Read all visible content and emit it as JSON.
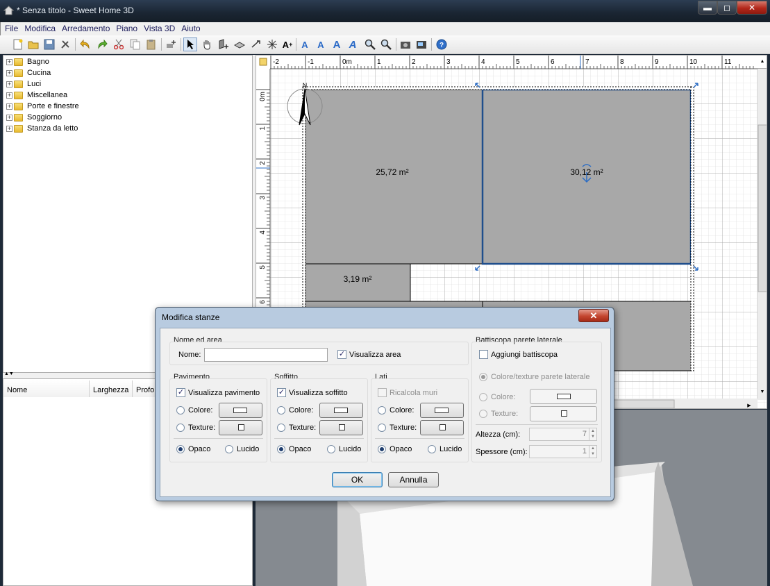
{
  "window": {
    "title": "* Senza titolo - Sweet Home 3D",
    "minimize": "▬",
    "maximize": "◻",
    "close": "✕"
  },
  "menu": [
    "File",
    "Modifica",
    "Arredamento",
    "Piano",
    "Vista 3D",
    "Aiuto"
  ],
  "toolbar_icons": [
    "new-icon",
    "open-icon",
    "save-icon",
    "preferences-icon",
    "undo-icon",
    "redo-icon",
    "cut-icon",
    "copy-icon",
    "paste-icon",
    "add-furniture-icon",
    "select-icon",
    "pan-icon",
    "create-walls-icon",
    "create-rooms-icon",
    "create-dimensions-icon",
    "create-labels-icon",
    "add-text-icon",
    "text-style-1-icon",
    "text-style-2-icon",
    "text-style-3-icon",
    "text-style-4-icon",
    "zoom-in-icon",
    "zoom-out-icon",
    "create-photo-icon",
    "create-video-icon",
    "help-icon"
  ],
  "catalog": {
    "categories": [
      "Bagno",
      "Cucina",
      "Luci",
      "Miscellanea",
      "Porte e finestre",
      "Soggiorno",
      "Stanza da letto"
    ]
  },
  "furniture_table": {
    "columns": [
      "Nome",
      "Larghezza",
      "Profon"
    ]
  },
  "plan": {
    "ruler_x": [
      "-2",
      "-1",
      "0m",
      "1",
      "2",
      "3",
      "4",
      "5",
      "6",
      "7",
      "8",
      "9",
      "10",
      "11"
    ],
    "ruler_y": [
      "0m",
      "1",
      "2",
      "3",
      "4",
      "5",
      "6"
    ],
    "rooms": [
      {
        "area": "25,72 m²"
      },
      {
        "area": "30,12 m²"
      },
      {
        "area": "3,19 m²"
      }
    ]
  },
  "dialog": {
    "title": "Modifica stanze",
    "close": "✕",
    "name_area": {
      "group": "Nome ed area",
      "name_label": "Nome:",
      "name_value": "",
      "show_area": "Visualizza area",
      "show_area_checked": true
    },
    "floor": {
      "group": "Pavimento",
      "visible": "Visualizza pavimento",
      "color": "Colore:",
      "texture": "Texture:",
      "matt": "Opaco",
      "shiny": "Lucido"
    },
    "ceiling": {
      "group": "Soffitto",
      "visible": "Visualizza soffitto",
      "color": "Colore:",
      "texture": "Texture:",
      "matt": "Opaco",
      "shiny": "Lucido"
    },
    "sides": {
      "group": "Lati",
      "recompute": "Ricalcola muri",
      "color": "Colore:",
      "texture": "Texture:",
      "matt": "Opaco",
      "shiny": "Lucido"
    },
    "baseboard": {
      "group": "Battiscopa parete laterale",
      "add": "Aggiungi battiscopa",
      "same_as_wall": "Colore/texture parete laterale",
      "color": "Colore:",
      "texture": "Texture:",
      "height_label": "Altezza (cm):",
      "height_value": "7",
      "thickness_label": "Spessore (cm):",
      "thickness_value": "1"
    },
    "ok": "OK",
    "cancel": "Annulla"
  },
  "colors": {
    "room_fill": "#a8a8a8",
    "selected_outline": "#1f4e8c",
    "titlebar": "#1a2532"
  }
}
